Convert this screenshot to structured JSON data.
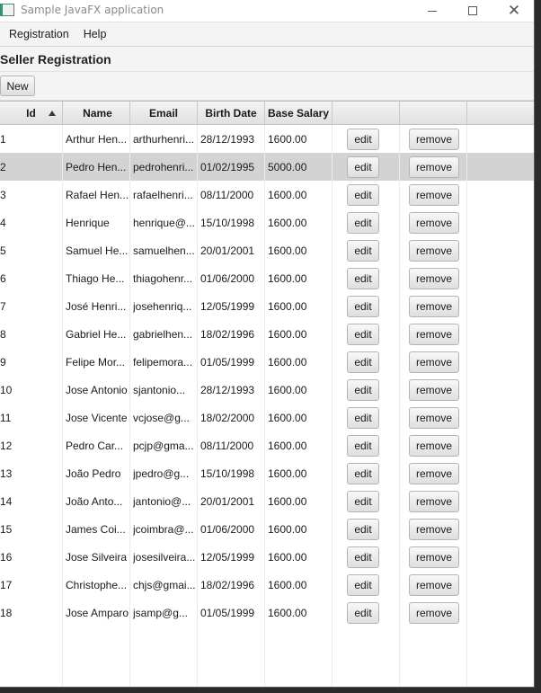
{
  "window": {
    "title": "Sample JavaFX application"
  },
  "menu": {
    "items": [
      "Registration",
      "Help"
    ]
  },
  "view": {
    "title": "Seller Registration",
    "new_label": "New"
  },
  "table": {
    "columns": [
      "Id",
      "Name",
      "Email",
      "Birth Date",
      "Base Salary",
      "",
      "",
      ""
    ],
    "sort_column": "Id",
    "sort_direction": "ascending",
    "edit_label": "edit",
    "remove_label": "remove",
    "selected_row_index": 1,
    "rows": [
      [
        "1",
        "Arthur Hen...",
        "arthurhenri...",
        "28/12/1993",
        "1600.00"
      ],
      [
        "2",
        "Pedro Hen...",
        "pedrohenri...",
        "01/02/1995",
        "5000.00"
      ],
      [
        "3",
        "Rafael Hen...",
        "rafaelhenri...",
        "08/11/2000",
        "1600.00"
      ],
      [
        "4",
        "Henrique",
        "henrique@...",
        "15/10/1998",
        "1600.00"
      ],
      [
        "5",
        "Samuel He...",
        "samuelhen...",
        "20/01/2001",
        "1600.00"
      ],
      [
        "6",
        "Thiago He...",
        "thiagohenr...",
        "01/06/2000",
        "1600.00"
      ],
      [
        "7",
        "José Henri...",
        "josehenriq...",
        "12/05/1999",
        "1600.00"
      ],
      [
        "8",
        "Gabriel He...",
        "gabrielhen...",
        "18/02/1996",
        "1600.00"
      ],
      [
        "9",
        "Felipe Mor...",
        "felipemora...",
        "01/05/1999",
        "1600.00"
      ],
      [
        "10",
        "Jose Antonio",
        "sjantonio...",
        "28/12/1993",
        "1600.00"
      ],
      [
        "11",
        "Jose Vicente",
        "vcjose@g...",
        "18/02/2000",
        "1600.00"
      ],
      [
        "12",
        "Pedro Car...",
        "pcjp@gma...",
        "08/11/2000",
        "1600.00"
      ],
      [
        "13",
        "João Pedro",
        "jpedro@g...",
        "15/10/1998",
        "1600.00"
      ],
      [
        "14",
        "João Anto...",
        "jantonio@...",
        "20/01/2001",
        "1600.00"
      ],
      [
        "15",
        "James Coi...",
        "jcoimbra@...",
        "01/06/2000",
        "1600.00"
      ],
      [
        "16",
        "Jose Silveira",
        "josesilveira...",
        "12/05/1999",
        "1600.00"
      ],
      [
        "17",
        "Christophe...",
        "chjs@gmai...",
        "18/02/1996",
        "1600.00"
      ],
      [
        "18",
        "Jose Amparo",
        "jsamp@g...",
        "01/05/1999",
        "1600.00"
      ]
    ]
  },
  "colors": {
    "selected_row": "#d3d3d3",
    "header_bg": "#e8e8e8",
    "window_bg": "#f4f4f4"
  }
}
